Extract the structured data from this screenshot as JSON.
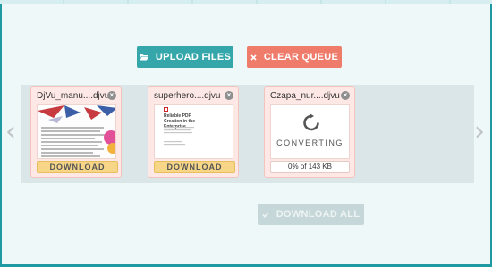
{
  "toolbar": {
    "upload_label": "UPLOAD FILES",
    "clear_label": "CLEAR QUEUE",
    "download_all_label": "DOWNLOAD ALL"
  },
  "nav": {
    "prev_glyph": "‹",
    "next_glyph": "›"
  },
  "files": [
    {
      "name": "DjVu_manu....djvu",
      "action_label": "DOWNLOAD",
      "status": "done"
    },
    {
      "name": "superhero....djvu",
      "action_label": "DOWNLOAD",
      "status": "done",
      "preview_title": "Reliable PDF Creation in the Enterprise"
    },
    {
      "name": "Czapa_nur....djvu",
      "status": "converting",
      "status_label": "CONVERTING",
      "progress_text": "0% of 143 KB",
      "progress_fraction": 0
    }
  ],
  "colors": {
    "upload": "#35a7ab",
    "clear": "#ef7b6b",
    "download_all_disabled": "#c5d7d8",
    "card_bg": "#fde8e6",
    "download_btn": "#f7d687",
    "frame_border": "#1f9aa2"
  },
  "icons": {
    "upload": "folder-open-icon",
    "clear": "close-x-icon",
    "download_all": "check-icon",
    "converting": "refresh-icon",
    "remove": "close-circle-icon"
  }
}
